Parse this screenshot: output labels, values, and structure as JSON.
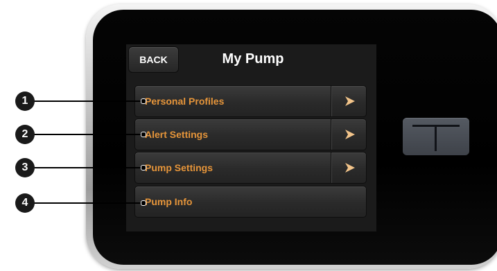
{
  "header": {
    "back_label": "BACK",
    "title": "My Pump"
  },
  "menu": {
    "items": [
      {
        "label": "Personal Profiles",
        "has_arrow": true,
        "callout": "1"
      },
      {
        "label": "Alert Settings",
        "has_arrow": true,
        "callout": "2"
      },
      {
        "label": "Pump Settings",
        "has_arrow": true,
        "callout": "3"
      },
      {
        "label": "Pump Info",
        "has_arrow": false,
        "callout": "4"
      }
    ]
  },
  "icons": {
    "arrow": "chevron-right-icon",
    "device_button": "t-logo-icon"
  },
  "colors": {
    "menu_label": "#e6953a",
    "arrow": "#f2c48a",
    "screen_background": "#1b1b1b",
    "callout": "#1a1a1a"
  }
}
